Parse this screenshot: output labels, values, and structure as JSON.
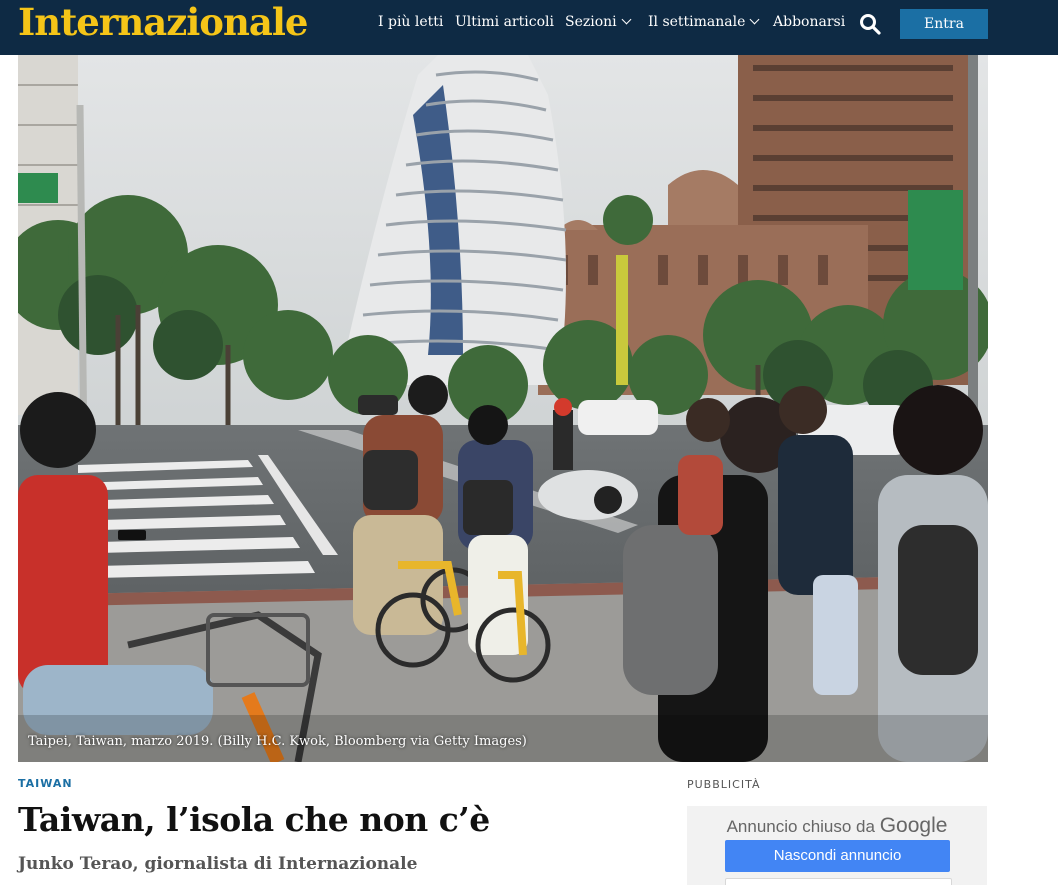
{
  "header": {
    "logo": "Internazionale",
    "nav": [
      {
        "label": "I più letti",
        "has_dropdown": false
      },
      {
        "label": "Ultimi articoli",
        "has_dropdown": false
      },
      {
        "label": "Sezioni",
        "has_dropdown": true
      },
      {
        "label": "Il settimanale",
        "has_dropdown": true
      },
      {
        "label": "Abbonarsi",
        "has_dropdown": false
      }
    ],
    "search_icon": "search-icon",
    "login_label": "Entra",
    "colors": {
      "bar": "#0e2a44",
      "logo": "#f5c518",
      "button": "#1b6fa4"
    }
  },
  "hero": {
    "caption": "Taipei, Taiwan, marzo 2019. (Billy H.C. Kwok, Bloomberg via Getty Images)"
  },
  "article": {
    "kicker": "TAIWAN",
    "title": "Taiwan, l’isola che non c’è",
    "byline": "Junko Terao, giornalista di Internazionale"
  },
  "ad": {
    "label": "PUBBLICITÀ",
    "closed_text": "Annuncio chiuso da",
    "google": "Google",
    "hide_button": "Nascondi annuncio"
  }
}
